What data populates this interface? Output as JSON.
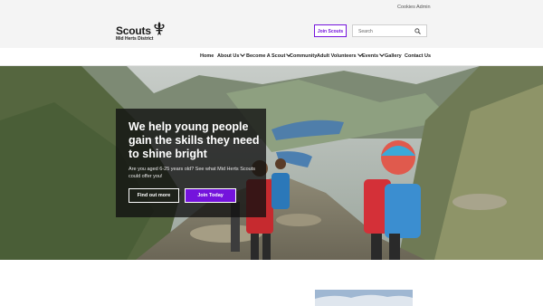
{
  "utility": {
    "links": [
      "Cookies",
      "Admin"
    ]
  },
  "header": {
    "logo_word": "Scouts",
    "logo_subtitle": "Mid Herts District",
    "join_label": "Join Scouts",
    "search_placeholder": "Search"
  },
  "nav": {
    "items": [
      {
        "label": "Home"
      },
      {
        "label": "About Us"
      },
      {
        "label": "Become A Scout"
      },
      {
        "label": "Community"
      },
      {
        "label": "Adult Volunteers"
      },
      {
        "label": "Events"
      },
      {
        "label": "Gallery"
      },
      {
        "label": "Contact Us"
      }
    ]
  },
  "hero": {
    "title": "We help young people gain the skills they need to shine bright",
    "subtitle": "Are you aged 6-25 years old? See what Mid Herts Scouts could offer you!",
    "primary_label": "Find out more",
    "secondary_label": "Join Today"
  },
  "colors": {
    "brand_purple": "#7413dc",
    "hero_overlay": "#0f0f0f"
  },
  "icons": [
    "fleur-de-lis-icon",
    "search-icon",
    "chevron-down-icon"
  ]
}
